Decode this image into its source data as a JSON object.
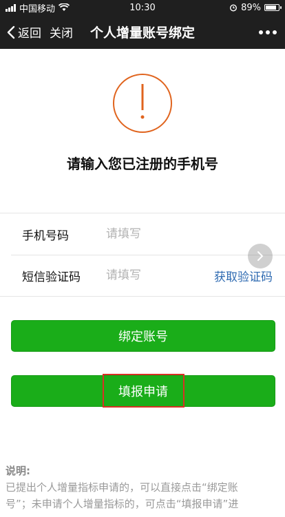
{
  "status_bar": {
    "carrier": "中国移动",
    "time": "10:30",
    "battery": "89%",
    "icons": [
      "signal-icon",
      "wifi-icon",
      "alarm-icon",
      "battery-icon"
    ]
  },
  "nav": {
    "back_label": "返回",
    "close_label": "关闭",
    "title": "个人增量账号绑定"
  },
  "notice": {
    "icon": "exclamation-circle-icon",
    "accent_color": "#e0641e",
    "headline": "请输入您已注册的手机号"
  },
  "form": {
    "phone": {
      "label": "手机号码",
      "placeholder": "请填写"
    },
    "sms": {
      "label": "短信验证码",
      "placeholder": "请填写",
      "get_code_label": "获取验证码"
    }
  },
  "buttons": {
    "bind_label": "绑定账号",
    "apply_label": "填报申请",
    "color": "#1aad19"
  },
  "explanation": {
    "title": "说明:",
    "line1": "已提出个人增量指标申请的，可以直接点击“绑定账",
    "line2": "号”；未申请个人增量指标的，可点击“填报申请”进"
  }
}
